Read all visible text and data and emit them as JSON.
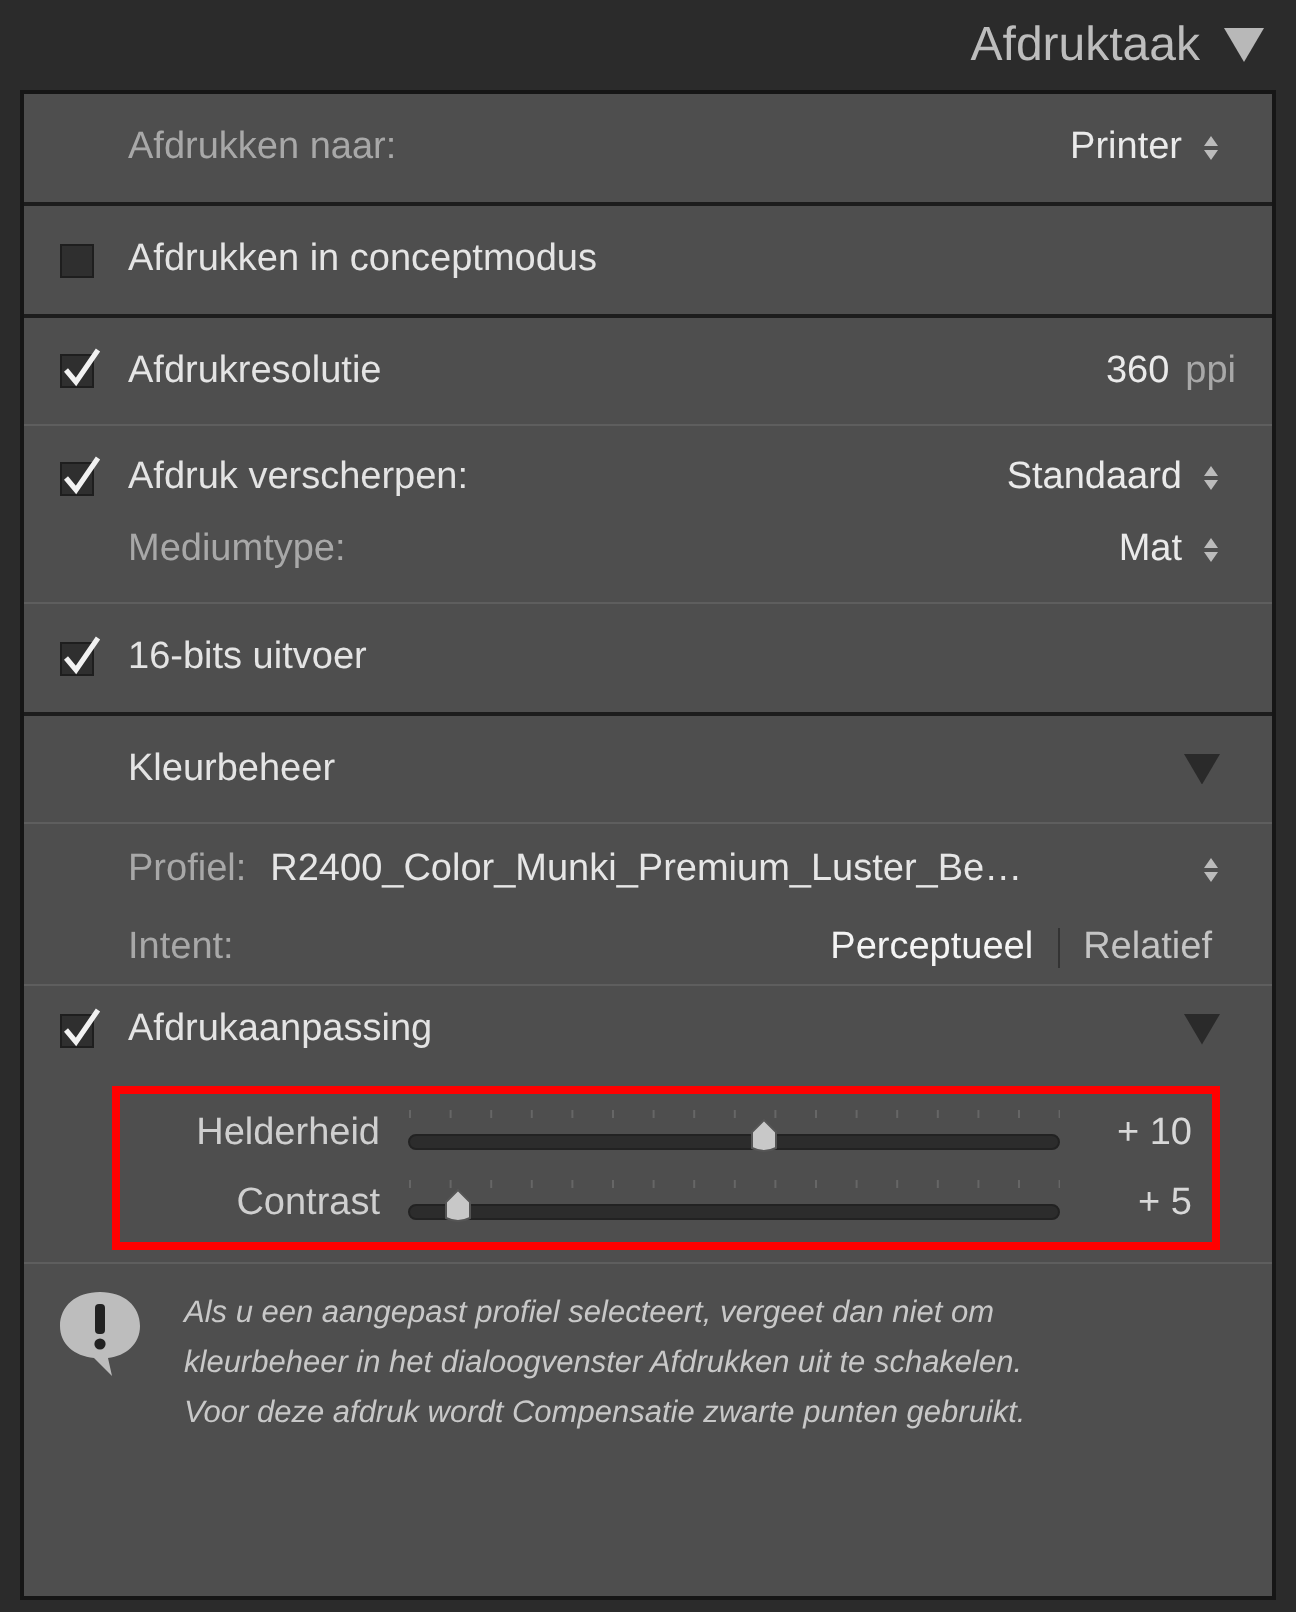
{
  "header": {
    "title": "Afdruktaak"
  },
  "print_to": {
    "label": "Afdrukken naar:",
    "value": "Printer"
  },
  "draft_mode": {
    "label": "Afdrukken in conceptmodus",
    "checked": false
  },
  "resolution": {
    "label": "Afdrukresolutie",
    "checked": true,
    "value": "360",
    "unit": "ppi"
  },
  "sharpen": {
    "label": "Afdruk verscherpen:",
    "checked": true,
    "value": "Standaard",
    "media_label": "Mediumtype:",
    "media_value": "Mat"
  },
  "bit_output": {
    "label": "16-bits uitvoer",
    "checked": true
  },
  "color_management": {
    "title": "Kleurbeheer",
    "profile_label": "Profiel:",
    "profile_value": "R2400_Color_Munki_Premium_Luster_Be…",
    "intent_label": "Intent:",
    "intents": [
      {
        "label": "Perceptueel",
        "selected": true
      },
      {
        "label": "Relatief",
        "selected": false
      }
    ]
  },
  "print_adjustment": {
    "label": "Afdrukaanpassing",
    "checked": true,
    "sliders": [
      {
        "label": "Helderheid",
        "level": 0.545,
        "reading": "+ 10"
      },
      {
        "label": "Contrast",
        "level": 0.077,
        "reading": "+ 5"
      }
    ]
  },
  "note": "Als u een aangepast profiel selecteert, vergeet dan niet om\nkleurbeheer in het dialoogvenster Afdrukken uit te schakelen.\nVoor deze afdruk wordt Compensatie zwarte punten gebruikt."
}
